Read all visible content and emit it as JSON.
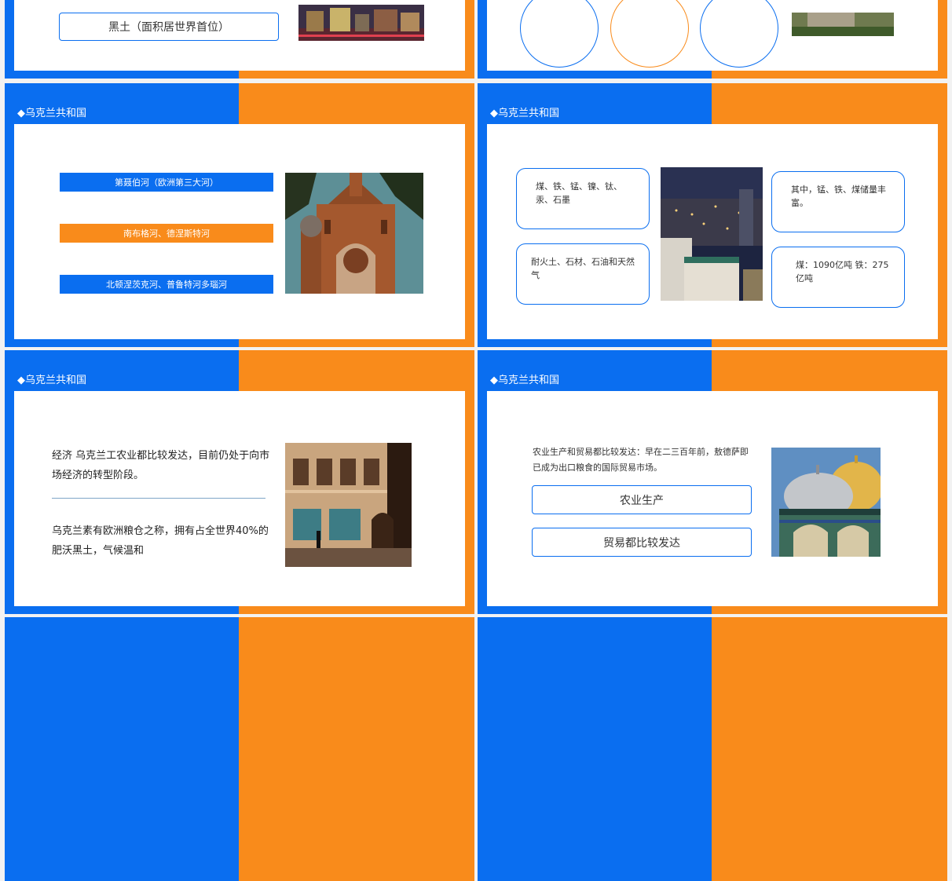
{
  "slides": {
    "top_left": {
      "box_text": "黑土（面积居世界首位）"
    },
    "river": {
      "header": "◆乌克兰共和国",
      "bars": [
        "第聂伯河（欧洲第三大河）",
        "南布格河、德涅斯特河",
        "北顿涅茨克河、普鲁特河多瑙河"
      ]
    },
    "minerals": {
      "header": "◆乌克兰共和国",
      "boxes": [
        "煤、铁、锰、镍、钛、汞、石墨",
        "耐火土、石材、石油和天然气",
        "其中，锰、铁、煤储量丰富。",
        "煤：1090亿吨  铁：275亿吨"
      ]
    },
    "economy": {
      "header": "◆乌克兰共和国",
      "para1": "经济 乌克兰工农业都比较发达，目前仍处于向市场经济的转型阶段。",
      "para2": "乌克兰素有欧洲粮仓之称，拥有占全世界40%的肥沃黑土，气候温和"
    },
    "agriculture": {
      "header": "◆乌克兰共和国",
      "text": "农业生产和贸易都比较发达：早在二三百年前，敖德萨即已成为出口粮食的国际贸易市场。",
      "btn1": "农业生产",
      "btn2": "贸易都比较发达"
    }
  },
  "colors": {
    "blue": "#0a6ef0",
    "orange": "#f98b1b",
    "white": "#ffffff"
  },
  "icons": {
    "header_marker": "diamond"
  }
}
